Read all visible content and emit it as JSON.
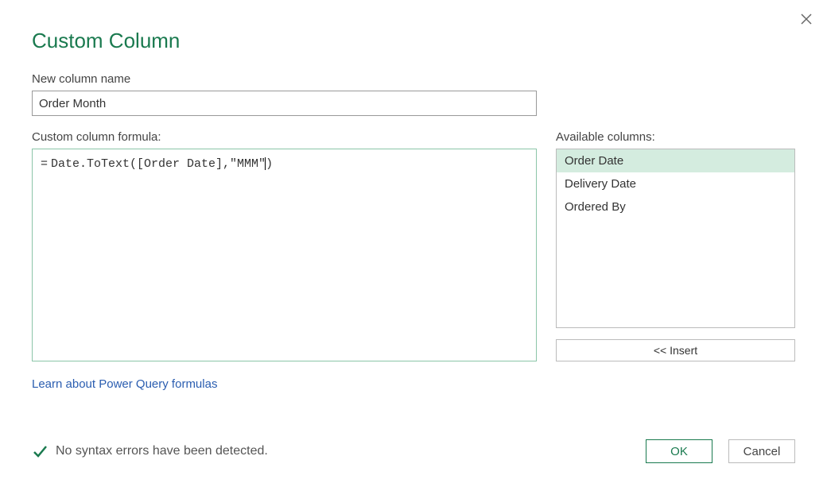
{
  "dialog": {
    "title": "Custom Column",
    "close_tooltip": "Close"
  },
  "new_column": {
    "label": "New column name",
    "value": "Order Month"
  },
  "formula": {
    "label": "Custom column formula:",
    "prefix": "=",
    "value": "Date.ToText([Order Date],\"MMM\")"
  },
  "available": {
    "label": "Available columns:",
    "items": [
      "Order Date",
      "Delivery Date",
      "Ordered By"
    ],
    "selected_index": 0,
    "insert_label": "<< Insert"
  },
  "learn_link": "Learn about Power Query formulas",
  "status": {
    "text": "No syntax errors have been detected.",
    "icon": "check"
  },
  "buttons": {
    "ok": "OK",
    "cancel": "Cancel"
  }
}
